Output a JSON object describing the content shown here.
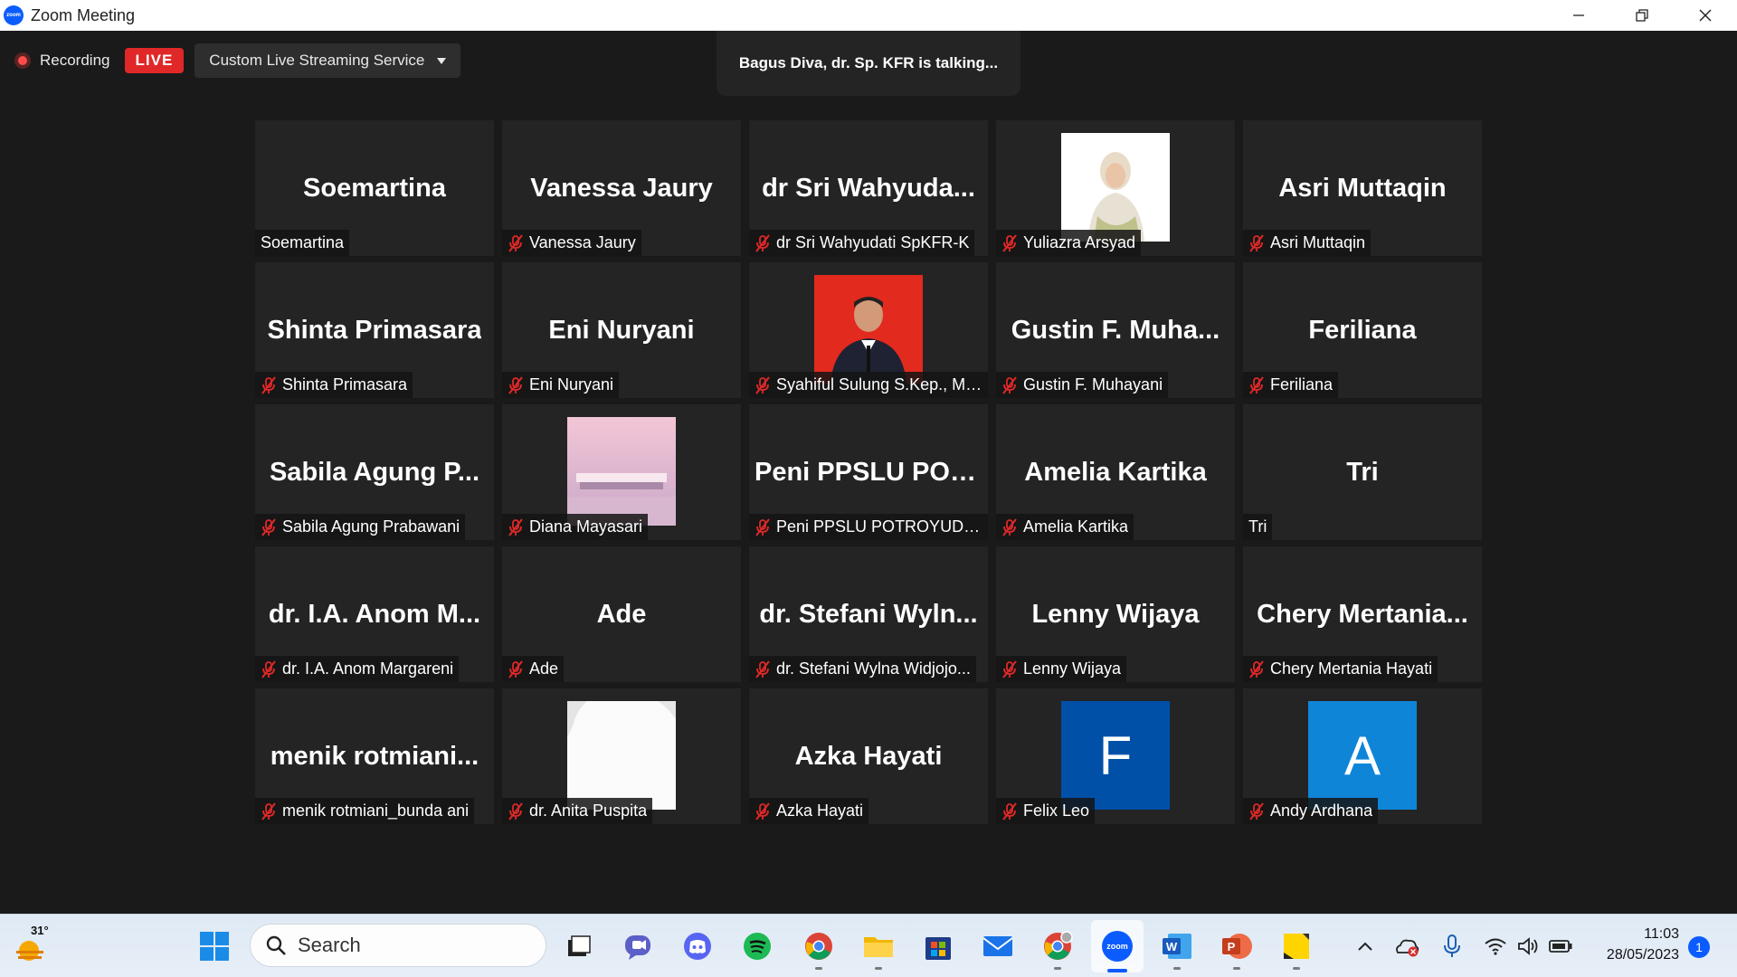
{
  "window": {
    "title": "Zoom Meeting",
    "app_icon_label": "zoom"
  },
  "recording": {
    "label": "Recording",
    "live_badge": "LIVE",
    "stream_service": "Custom Live Streaming Service"
  },
  "talking_banner": "Bagus Diva, dr. Sp. KFR is talking...",
  "participants": [
    {
      "display": "Soemartina",
      "name": "Soemartina",
      "muted": false,
      "pic": null
    },
    {
      "display": "Vanessa Jaury",
      "name": "Vanessa Jaury",
      "muted": true,
      "pic": null
    },
    {
      "display": "dr Sri  Wahyuda...",
      "name": "dr Sri Wahyudati SpKFR-K",
      "muted": true,
      "pic": null
    },
    {
      "display": "",
      "name": "Yuliazra Arsyad",
      "muted": true,
      "pic": "photo-woman"
    },
    {
      "display": "Asri Muttaqin",
      "name": "Asri Muttaqin",
      "muted": true,
      "pic": null
    },
    {
      "display": "Shinta Primasara",
      "name": "Shinta Primasara",
      "muted": true,
      "pic": null
    },
    {
      "display": "Eni Nuryani",
      "name": "Eni Nuryani",
      "muted": true,
      "pic": null
    },
    {
      "display": "",
      "name": "Syahiful Sulung S.Kep., M....",
      "muted": true,
      "pic": "photo-man-red"
    },
    {
      "display": "Gustin  F.  Muha...",
      "name": "Gustin F. Muhayani",
      "muted": true,
      "pic": null
    },
    {
      "display": "Feriliana",
      "name": "Feriliana",
      "muted": true,
      "pic": null
    },
    {
      "display": "Sabila  Agung  P...",
      "name": "Sabila Agung Prabawani",
      "muted": true,
      "pic": null
    },
    {
      "display": "",
      "name": "Diana Mayasari",
      "muted": true,
      "pic": "photo-pink"
    },
    {
      "display": "Peni  PPSLU  POT...",
      "name": "Peni PPSLU POTROYUDAN",
      "muted": true,
      "pic": null
    },
    {
      "display": "Amelia Kartika",
      "name": "Amelia Kartika",
      "muted": true,
      "pic": null
    },
    {
      "display": "Tri",
      "name": "Tri",
      "muted": false,
      "pic": null
    },
    {
      "display": "dr. I.A.  Anom  M...",
      "name": "dr. I.A. Anom Margareni",
      "muted": true,
      "pic": null
    },
    {
      "display": "Ade",
      "name": "Ade",
      "muted": true,
      "pic": null
    },
    {
      "display": "dr.  Stefani  Wyln...",
      "name": "dr. Stefani Wylna Widjojo...",
      "muted": true,
      "pic": null
    },
    {
      "display": "Lenny Wijaya",
      "name": "Lenny Wijaya",
      "muted": true,
      "pic": null
    },
    {
      "display": "Chery  Mertania...",
      "name": "Chery Mertania Hayati",
      "muted": true,
      "pic": null
    },
    {
      "display": "menik  rotmiani...",
      "name": "menik rotmiani_bunda ani",
      "muted": true,
      "pic": null
    },
    {
      "display": "",
      "name": "dr. Anita Puspita",
      "muted": true,
      "pic": "photo-white"
    },
    {
      "display": "Azka Hayati",
      "name": "Azka Hayati",
      "muted": true,
      "pic": null
    },
    {
      "display": "",
      "name": "Felix Leo",
      "muted": true,
      "pic": "letter",
      "letter": "F",
      "letter_bg": "#0050a8"
    },
    {
      "display": "",
      "name": "Andy Ardhana",
      "muted": true,
      "pic": "letter",
      "letter": "A",
      "letter_bg": "#0f85d8"
    }
  ],
  "taskbar": {
    "temperature": "31°",
    "search_placeholder": "Search",
    "time": "11:03",
    "date": "28/05/2023",
    "notification_count": "1",
    "zoom_icon_label": "zoom",
    "apps": [
      "task-view",
      "teams-chat",
      "discord",
      "spotify",
      "chrome",
      "file-explorer",
      "microsoft-store",
      "mail",
      "chrome-profile",
      "zoom",
      "word",
      "powerpoint",
      "sticky-notes"
    ]
  },
  "colors": {
    "meeting_bg": "#1a1a1a",
    "tile_bg": "#242424",
    "mute_red": "#e02828",
    "live_red": "#e02828",
    "zoom_blue": "#0b5cff"
  }
}
